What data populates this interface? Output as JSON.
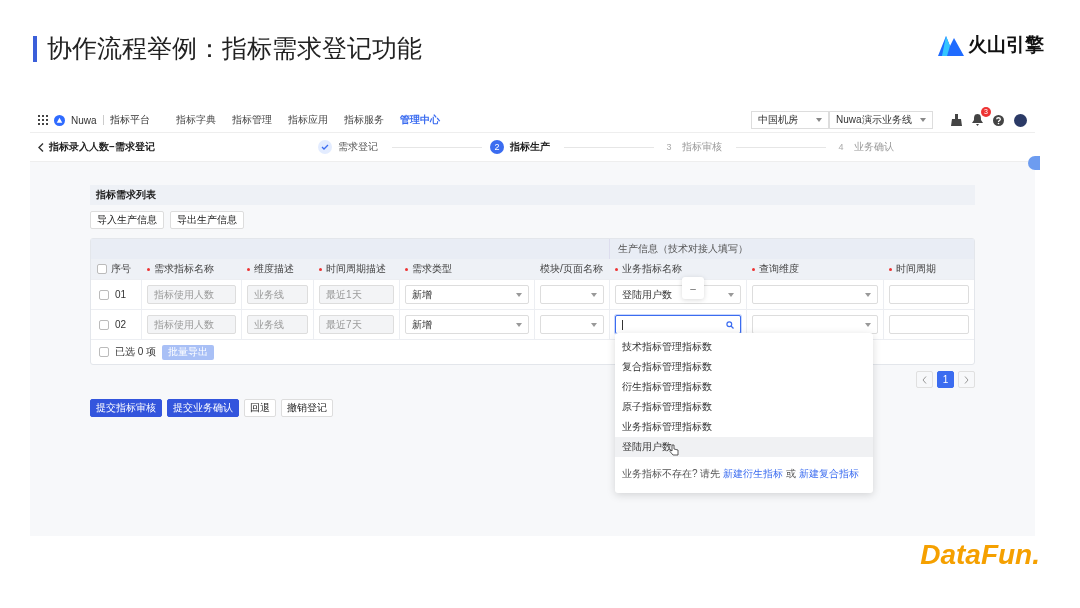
{
  "slide": {
    "title": "协作流程举例：指标需求登记功能",
    "brand": "火山引擎",
    "footer_brand": "DataFun."
  },
  "app": {
    "nav": {
      "app_name": "Nuwa",
      "platform": "指标平台",
      "items": [
        {
          "label": "指标字典",
          "selected": false
        },
        {
          "label": "指标管理",
          "selected": false
        },
        {
          "label": "指标应用",
          "selected": false
        },
        {
          "label": "指标服务",
          "selected": false
        },
        {
          "label": "管理中心",
          "selected": true
        }
      ],
      "selects": [
        {
          "value": "中国机房"
        },
        {
          "value": "Nuwa演示业务线"
        }
      ],
      "notification_count": "3"
    },
    "page": {
      "back_title": "指标录入人数–需求登记",
      "steps": [
        {
          "label": "需求登记",
          "done": true,
          "selected": false
        },
        {
          "number": "2",
          "label": "指标生产",
          "done": false,
          "selected": true
        },
        {
          "number": "3",
          "label": "指标审核",
          "done": false,
          "selected": false
        },
        {
          "number": "4",
          "label": "业务确认",
          "done": false,
          "selected": false
        }
      ]
    },
    "section": {
      "title": "指标需求列表",
      "buttons": [
        "导入生产信息",
        "导出生产信息"
      ],
      "table": {
        "group_header": "生产信息（技术对接人填写）",
        "columns": [
          {
            "label": "序号",
            "required": false,
            "checked": false
          },
          {
            "label": "需求指标名称",
            "required": true
          },
          {
            "label": "维度描述",
            "required": true
          },
          {
            "label": "时间周期描述",
            "required": true
          },
          {
            "label": "需求类型",
            "required": true
          },
          {
            "label": "模块/页面名称",
            "required": false
          },
          {
            "label": "业务指标名称",
            "required": true
          },
          {
            "label": "查询维度",
            "required": true
          },
          {
            "label": "时间周期",
            "required": true
          }
        ],
        "rows": [
          {
            "cells": [
              {
                "kind": "index",
                "value": "01",
                "checked": false
              },
              {
                "kind": "input",
                "value": "指标使用人数"
              },
              {
                "kind": "input",
                "value": "业务线"
              },
              {
                "kind": "input",
                "value": "最近1天"
              },
              {
                "kind": "select",
                "value": "新增"
              },
              {
                "kind": "select"
              },
              {
                "kind": "select",
                "value": "登陆用户数"
              },
              {
                "kind": "select"
              },
              {
                "kind": "input"
              }
            ]
          },
          {
            "cells": [
              {
                "kind": "index",
                "value": "02",
                "checked": false
              },
              {
                "kind": "input",
                "value": "指标使用人数"
              },
              {
                "kind": "input",
                "value": "业务线"
              },
              {
                "kind": "input",
                "value": "最近7天"
              },
              {
                "kind": "select",
                "value": "新增"
              },
              {
                "kind": "select"
              },
              {
                "kind": "search"
              },
              {
                "kind": "select"
              },
              {
                "kind": "input"
              }
            ]
          }
        ],
        "footer": {
          "checked": false,
          "selected_text": "已选 0 项",
          "batch_button": "批量导出",
          "batch_disabled": true
        },
        "popover": "–",
        "dropdown": {
          "options": [
            {
              "label": "技术指标管理指标数",
              "selected": false
            },
            {
              "label": "复合指标管理指标数",
              "selected": false
            },
            {
              "label": "衍生指标管理指标数",
              "selected": false
            },
            {
              "label": "原子指标管理指标数",
              "selected": false
            },
            {
              "label": "业务指标管理指标数",
              "selected": false
            },
            {
              "label": "登陆用户数",
              "selected": true
            }
          ],
          "hint": "业务指标不存在? 请先",
          "link_1": "新建衍生指标",
          "connector": "或",
          "link_2": "新建复合指标"
        }
      },
      "pagination": [
        {
          "label": "1",
          "selected": true
        }
      ],
      "actions": [
        {
          "label": "提交指标审核",
          "kind": "primary"
        },
        {
          "label": "提交业务确认",
          "kind": "primary"
        },
        {
          "label": "回退",
          "kind": "default"
        },
        {
          "label": "撤销登记",
          "kind": "default"
        }
      ]
    }
  }
}
